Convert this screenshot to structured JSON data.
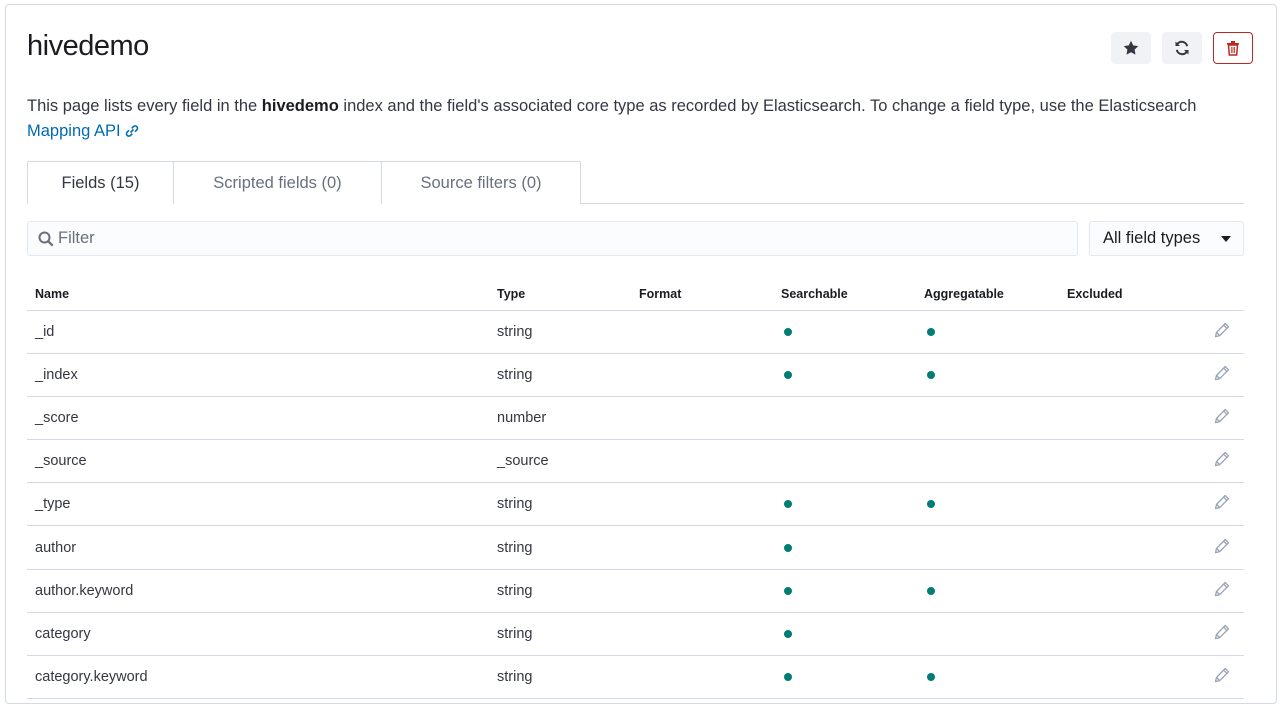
{
  "header": {
    "title": "hivedemo",
    "actions": [
      "star-icon",
      "refresh-icon",
      "trash-icon"
    ]
  },
  "description": {
    "text_before": "This page lists every field in the ",
    "index_name": "hivedemo",
    "text_after": " index and the field's associated core type as recorded by Elasticsearch. To change a field type, use the Elasticsearch ",
    "link_text": "Mapping API"
  },
  "tabs": [
    {
      "label": "Fields (15)",
      "active": true
    },
    {
      "label": "Scripted fields (0)",
      "active": false
    },
    {
      "label": "Source filters (0)",
      "active": false
    }
  ],
  "filter": {
    "placeholder": "Filter",
    "value": ""
  },
  "type_select": {
    "value": "All field types"
  },
  "table": {
    "columns": [
      "Name",
      "Type",
      "Format",
      "Searchable",
      "Aggregatable",
      "Excluded"
    ],
    "rows": [
      {
        "name": "_id",
        "type": "string",
        "format": "",
        "searchable": true,
        "aggregatable": true,
        "excluded": false
      },
      {
        "name": "_index",
        "type": "string",
        "format": "",
        "searchable": true,
        "aggregatable": true,
        "excluded": false
      },
      {
        "name": "_score",
        "type": "number",
        "format": "",
        "searchable": false,
        "aggregatable": false,
        "excluded": false
      },
      {
        "name": "_source",
        "type": "_source",
        "format": "",
        "searchable": false,
        "aggregatable": false,
        "excluded": false
      },
      {
        "name": "_type",
        "type": "string",
        "format": "",
        "searchable": true,
        "aggregatable": true,
        "excluded": false
      },
      {
        "name": "author",
        "type": "string",
        "format": "",
        "searchable": true,
        "aggregatable": false,
        "excluded": false
      },
      {
        "name": "author.keyword",
        "type": "string",
        "format": "",
        "searchable": true,
        "aggregatable": true,
        "excluded": false
      },
      {
        "name": "category",
        "type": "string",
        "format": "",
        "searchable": true,
        "aggregatable": false,
        "excluded": false
      },
      {
        "name": "category.keyword",
        "type": "string",
        "format": "",
        "searchable": true,
        "aggregatable": true,
        "excluded": false
      }
    ]
  },
  "colors": {
    "accent": "#006bb4",
    "indicator": "#017d73",
    "danger": "#bd271e"
  }
}
